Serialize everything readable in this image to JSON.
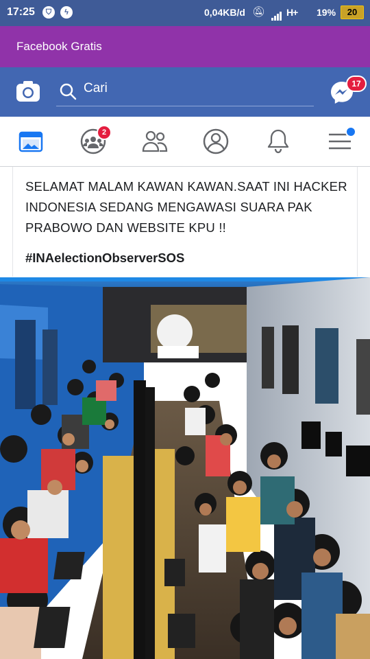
{
  "status_bar": {
    "time": "17:25",
    "network_speed": "0,04KB/d",
    "signal_type": "H+",
    "battery_percent": "19%",
    "battery_box": "20"
  },
  "promo_banner": {
    "text": "Facebook Gratis"
  },
  "header": {
    "search_placeholder": "Cari",
    "messenger_badge": "17"
  },
  "nav": {
    "tabs": [
      {
        "name": "news-feed",
        "icon": "news-feed-icon",
        "active": true
      },
      {
        "name": "groups",
        "icon": "groups-icon",
        "badge": "2"
      },
      {
        "name": "friends",
        "icon": "friends-icon"
      },
      {
        "name": "profile",
        "icon": "profile-icon"
      },
      {
        "name": "notifications",
        "icon": "bell-icon"
      },
      {
        "name": "menu",
        "icon": "hamburger-menu-icon",
        "dot": true
      }
    ]
  },
  "post": {
    "text": "SELAMAT MALAM KAWAN KAWAN.SAAT INI HACKER INDONESIA SEDANG MENGAWASI SUARA PAK PRABOWO DAN WEBSITE KPU !!",
    "hashtag": "#INAelectionObserverSOS"
  },
  "colors": {
    "status_bar": "#3f5b97",
    "promo": "#9033a9",
    "header": "#4267b2",
    "badge": "#e41e3f",
    "accent": "#1877f2"
  }
}
